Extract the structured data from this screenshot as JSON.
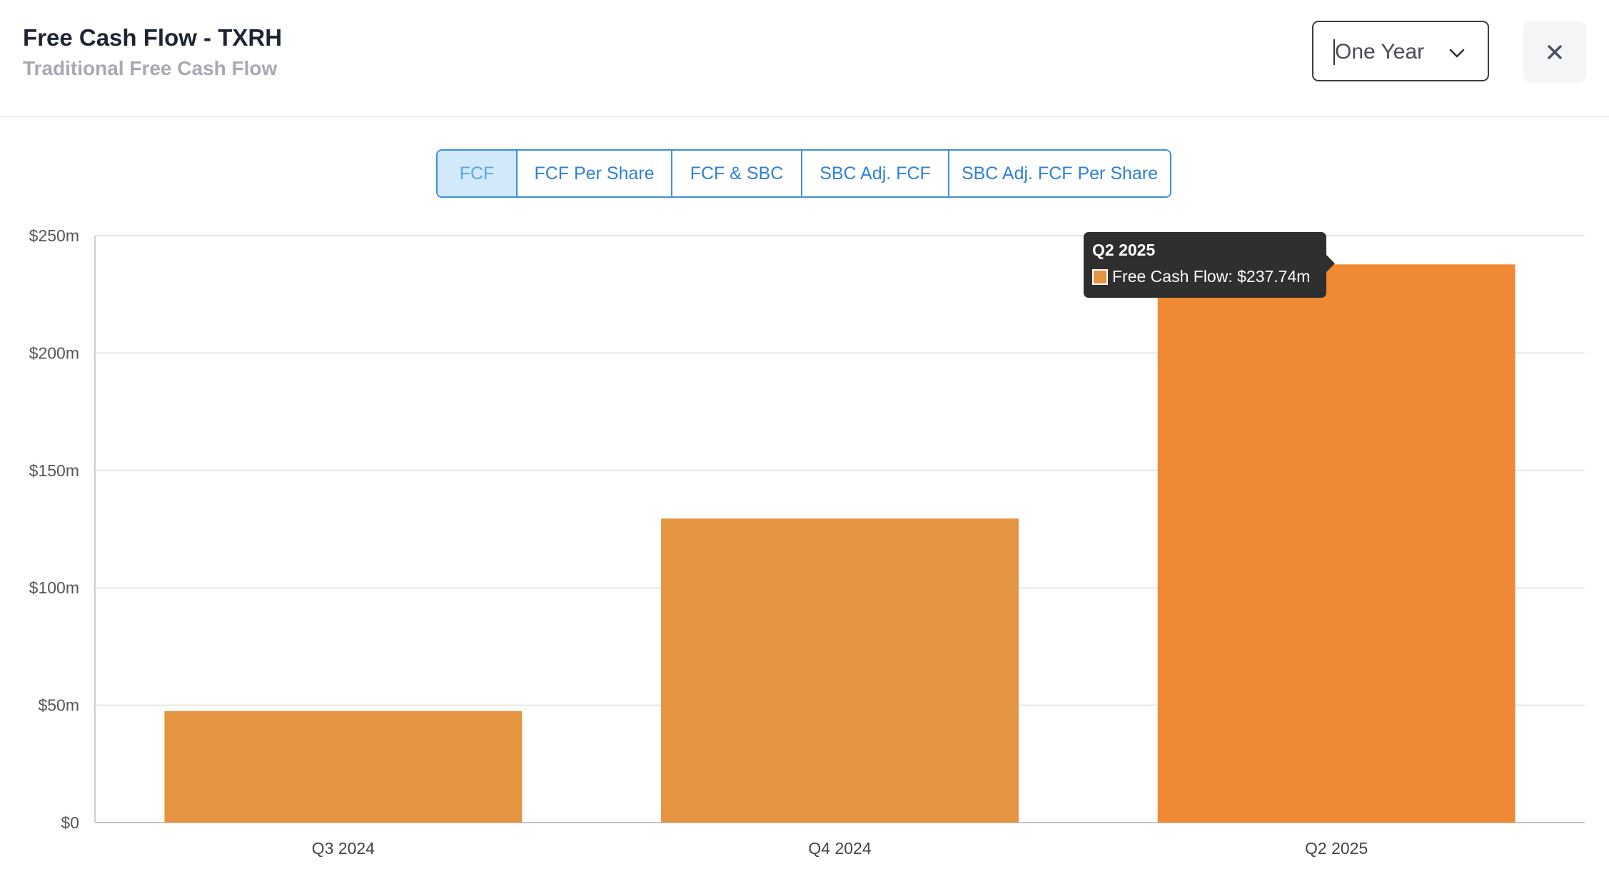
{
  "header": {
    "title": "Free Cash Flow - TXRH",
    "subtitle": "Traditional Free Cash Flow",
    "period_select": {
      "value": "One Year"
    },
    "close_icon": "close-icon",
    "chevron_icon": "chevron-down-icon"
  },
  "tabs": [
    {
      "label": "FCF",
      "active": true
    },
    {
      "label": "FCF Per Share",
      "active": false
    },
    {
      "label": "FCF & SBC",
      "active": false
    },
    {
      "label": "SBC Adj. FCF",
      "active": false
    },
    {
      "label": "SBC Adj. FCF Per Share",
      "active": false
    }
  ],
  "tooltip": {
    "title": "Q2 2025",
    "label": "Free Cash Flow: $237.74m"
  },
  "colors": {
    "bar": "#e59441",
    "bar_highlight": "#ef8933",
    "tab_border": "#3d8fde",
    "tab_active_bg": "#d2e9fb"
  },
  "chart_data": {
    "type": "bar",
    "categories": [
      "Q3 2024",
      "Q4 2024",
      "Q2 2025"
    ],
    "series": [
      {
        "name": "Free Cash Flow",
        "values": [
          47.5,
          129.5,
          237.74
        ]
      }
    ],
    "highlighted_index": 2,
    "yticks": [
      "$0",
      "$50m",
      "$100m",
      "$150m",
      "$200m",
      "$250m"
    ],
    "ylim": [
      0,
      250
    ],
    "grid": true
  }
}
